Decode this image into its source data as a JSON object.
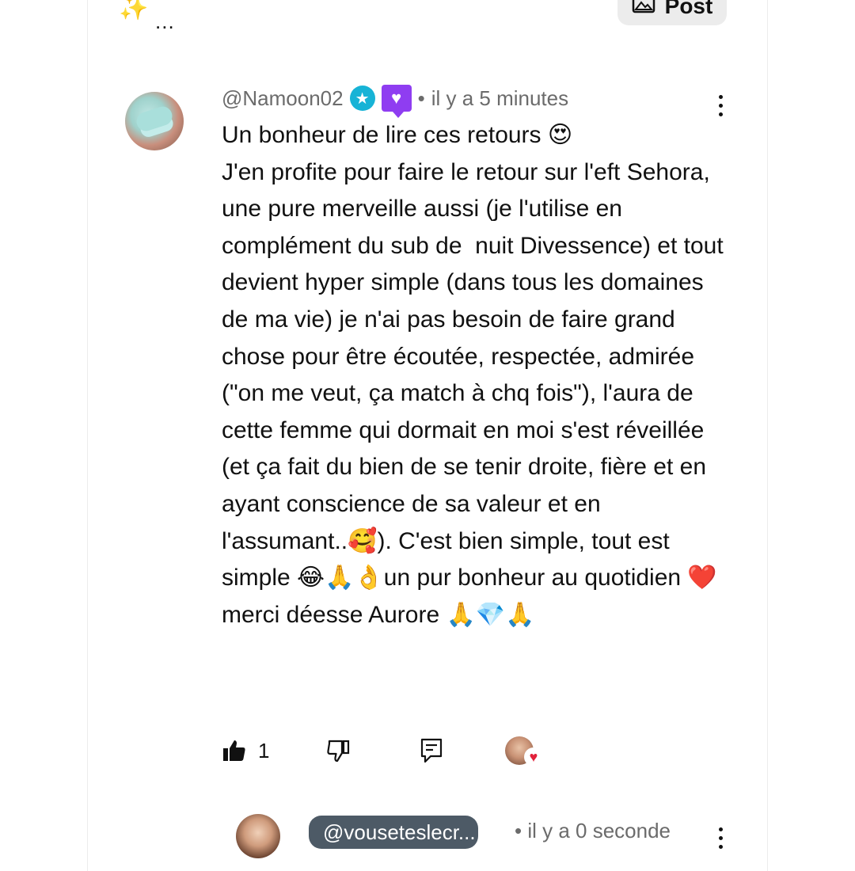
{
  "prev_comment": {
    "emoji": "✨",
    "ellipsis": "...",
    "post_button_label": "Post",
    "post_button_icon": "image-icon"
  },
  "comment": {
    "username": "@Namoon02",
    "badges": [
      "star-badge-icon",
      "heart-badge-icon"
    ],
    "separator": "•",
    "time": "il y a 5 minutes",
    "text": "Un bonheur de lire ces retours 😍\nJ'en profite pour faire le retour sur l'eft Sehora, une pure merveille aussi (je l'utilise en complément du sub de  nuit Divessence) et tout devient hyper simple (dans tous les domaines de ma vie) je n'ai pas besoin de faire grand chose pour être écoutée, respectée, admirée (\"on me veut, ça match à chq fois\"), l'aura de cette femme qui dormait en moi s'est réveillée (et ça fait du bien de se tenir droite, fière et en ayant conscience de sa valeur et en l'assumant..🥰). C'est bien simple, tout est simple 😂🙏👌un pur bonheur au quotidien ❤️merci déesse Aurore 🙏💎🙏",
    "like_count": "1",
    "hearted_symbol": "♥"
  },
  "reply": {
    "mention": "@vouseteslecr...",
    "separator": "•",
    "time": "il y a 0 seconde"
  },
  "colors": {
    "star_badge": "#17b3d6",
    "heart_badge": "#8f3df1",
    "mention_pill": "#4d5a66",
    "heart": "#e2223b",
    "meta_text": "#6b6b6b"
  }
}
